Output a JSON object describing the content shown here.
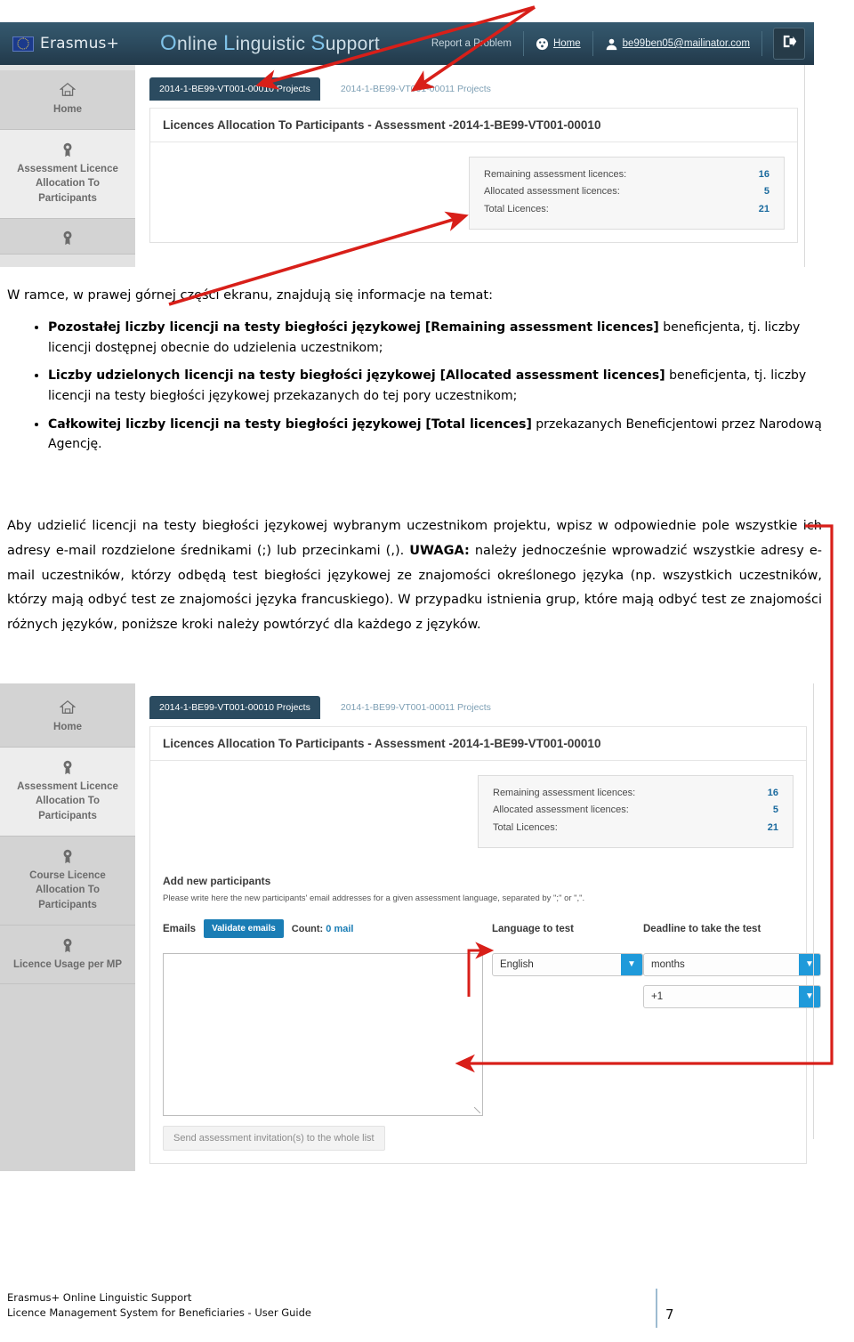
{
  "app": {
    "brand_left": "Erasmus+",
    "brand_title_parts": [
      "O",
      "nline ",
      "L",
      "inguistic ",
      "S",
      "upport"
    ],
    "brand_title": "Online Linguistic Support",
    "header_links": {
      "report_problem": "Report a Problem",
      "home": "Home",
      "user_email": "be99ben05@mailinator.com",
      "logout_icon": "logout-icon",
      "home_icon": "dashboard-icon",
      "user_icon": "user-icon"
    },
    "sidebar": [
      {
        "icon": "home-icon",
        "label": "Home"
      },
      {
        "icon": "badge-icon",
        "label": "Assessment Licence Allocation To Participants"
      },
      {
        "icon": "badge-icon",
        "label": "Course Licence Allocation To Participants"
      },
      {
        "icon": "badge-icon",
        "label": "Licence Usage per MP"
      }
    ],
    "tabs": [
      {
        "label": "2014-1-BE99-VT001-00010 Projects",
        "active": true
      },
      {
        "label": "2014-1-BE99-VT001-00011 Projects",
        "active": false
      }
    ],
    "panel_title": "Licences Allocation To Participants - Assessment -2014-1-BE99-VT001-00010",
    "licences": [
      {
        "label": "Remaining assessment licences:",
        "value": "16"
      },
      {
        "label": "Allocated assessment licences:",
        "value": "5"
      },
      {
        "label": "Total Licences:",
        "value": "21"
      }
    ],
    "add_participants": {
      "title": "Add new participants",
      "description": "Please write here the new participants' email addresses for a given assessment language, separated by \";\" or \",\".",
      "emails_label": "Emails",
      "validate_button": "Validate emails",
      "count_prefix": "Count: ",
      "count_value": "0 mail",
      "emails_value": "",
      "language_label": "Language to test",
      "language_value": "English",
      "deadline_label": "Deadline to take the test",
      "deadline_unit_value": "months",
      "deadline_amount_value": "+1",
      "send_button": "Send assessment invitation(s) to the whole list"
    },
    "colors": {
      "header_bg": "#2d4c60",
      "tab_active_bg": "#2b4b60",
      "accent_blue": "#1a7db5",
      "select_arrow_blue": "#1f9ada",
      "annotation_red": "#d81f19",
      "value_blue": "#1a6a9e"
    }
  },
  "document": {
    "lead": "W ramce, w prawej górnej części ekranu, znajdują się informacje na temat:",
    "bullets": [
      {
        "bold": "Pozostałej liczby licencji na testy biegłości językowej [Remaining assessment licences]",
        "rest": " beneficjenta, tj. liczby licencji dostępnej obecnie do udzielenia uczestnikom;"
      },
      {
        "bold": "Liczby udzielonych licencji na testy biegłości językowej [Allocated assessment licences]",
        "rest": " beneficjenta, tj. liczby licencji na testy biegłości językowej przekazanych do tej pory uczestnikom;"
      },
      {
        "bold": "Całkowitej liczby licencji na testy biegłości językowej [Total licences]",
        "rest": " przekazanych Beneficjentowi przez Narodową Agencję."
      }
    ],
    "paragraph_part1": "Aby udzielić licencji na testy biegłości językowej wybranym uczestnikom projektu, wpisz w odpowiednie pole wszystkie ich adresy e-mail rozdzielone średnikami (;) lub przecinkami (,). ",
    "paragraph_bold": "UWAGA:",
    "paragraph_part2": " należy jednocześnie wprowadzić wszystkie adresy e-mail uczestników, którzy odbędą test biegłości językowej ze znajomości określonego języka (np. wszystkich uczestników, którzy mają odbyć test ze znajomości języka francuskiego). W przypadku istnienia grup, które mają odbyć test ze znajomości różnych języków, poniższe kroki należy powtórzyć dla każdego z języków."
  },
  "footer": {
    "line1": "Erasmus+ Online Linguistic Support",
    "line2": "Licence Management System for Beneficiaries - User Guide",
    "page_number": "7"
  }
}
